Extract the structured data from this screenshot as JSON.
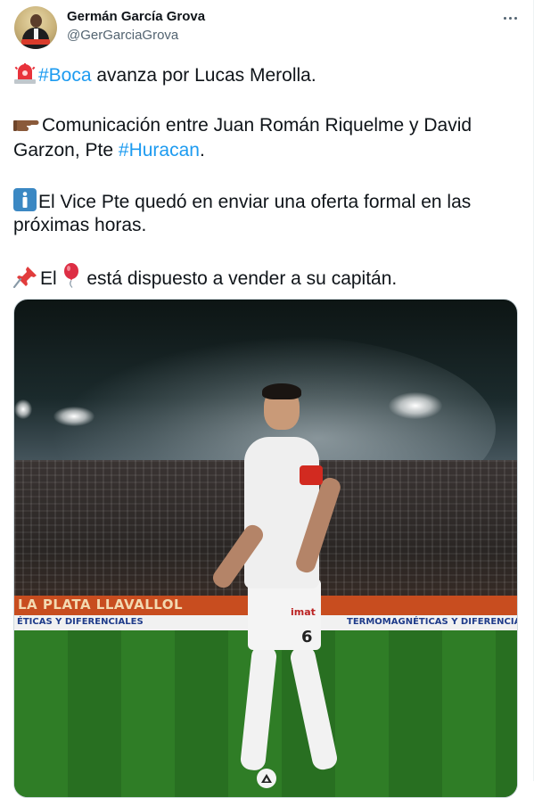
{
  "author": {
    "display_name": "Germán García Grova",
    "handle": "@GerGarciaGrova",
    "avatar_icon": "user-avatar"
  },
  "more_icon": "ellipsis-icon",
  "tweet": {
    "line1": {
      "emoji": "rotating-light-emoji",
      "hashtag": "#Boca",
      "text": " avanza por Lucas Merolla."
    },
    "line2": {
      "emoji": "pointing-right-emoji",
      "text": "Comunicación entre Juan Román Riquelme y David"
    },
    "line3": {
      "text": "Garzon, Pte ",
      "hashtag": "#Huracan",
      "text_after": "."
    },
    "line4": {
      "emoji": "information-emoji",
      "text": "El Vice Pte quedó en enviar una oferta formal en las"
    },
    "line5": {
      "text": "próximas horas."
    },
    "line6": {
      "emoji1": "pushpin-emoji",
      "text1": "El ",
      "emoji2": "balloon-emoji",
      "text2": " está dispuesto a vender a su capitán."
    }
  },
  "media": {
    "adboard_text": "LA PLATA  LLAVALLOL",
    "band_left": "ÉTICAS Y DIFERENCIALES",
    "band_mid": "TERMOMAGNÉTICAS Y DIFERENCIALES",
    "sponsor": "imat",
    "shirt_number": "6"
  },
  "colors": {
    "link": "#1d9bf0",
    "text": "#0f1419",
    "secondary": "#536471"
  }
}
